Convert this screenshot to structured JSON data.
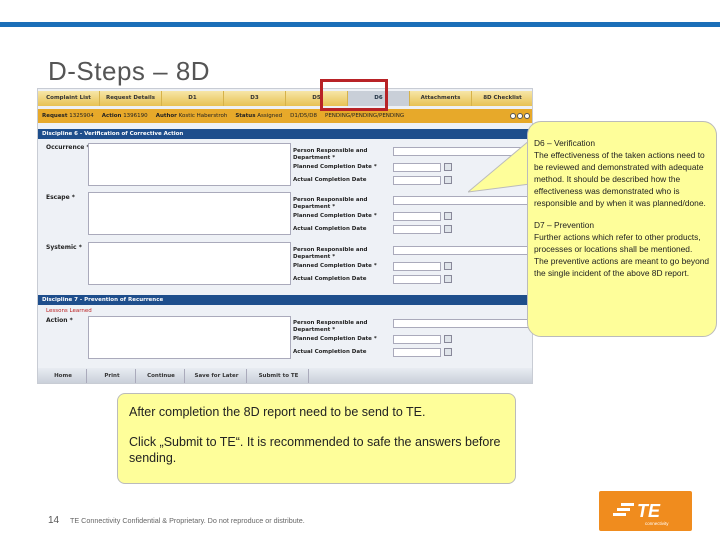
{
  "slide": {
    "title": "D-Steps – 8D",
    "page_number": "14",
    "footer": "TE Connectivity Confidential & Proprietary. Do not reproduce or distribute."
  },
  "app": {
    "tabs": [
      {
        "label": "Complaint List",
        "active": false
      },
      {
        "label": "Request Details",
        "active": false
      },
      {
        "label": "D1",
        "active": false
      },
      {
        "label": "D3",
        "active": false
      },
      {
        "label": "D5",
        "active": false
      },
      {
        "label": "D6",
        "active": true
      },
      {
        "label": "Attachments",
        "active": false
      },
      {
        "label": "8D Checklist",
        "active": false
      }
    ],
    "info": {
      "request_label": "Request",
      "request_value": "1325904",
      "action_label": "Action",
      "action_value": "1396190",
      "author_label": "Author",
      "author_value": "Kostic Haberstroh",
      "status_label": "Status",
      "status_value": "Assigned",
      "steps_value": "D1/D5/D8",
      "pending_value": "PENDING/PENDING/PENDING"
    },
    "section6": {
      "title": "Discipline 6 - Verification of Corrective Action",
      "rows": [
        {
          "label": "Occurrence *"
        },
        {
          "label": "Escape *"
        },
        {
          "label": "Systemic *"
        }
      ]
    },
    "section7": {
      "title": "Discipline 7 - Prevention of Recurrence",
      "lessons": "Lessons Learned",
      "action_label": "Action *"
    },
    "field_labels": {
      "person": "Person Responsible and Department *",
      "planned": "Planned Completion Date *",
      "actual": "Actual Completion Date"
    },
    "buttons": [
      "Home",
      "Print",
      "Continue",
      "Save for Later",
      "Submit to TE"
    ]
  },
  "callout": {
    "d6_title": "D6 – Verification",
    "d6_text": "The effectiveness of the taken actions need to be reviewed and demonstrated with adequate method. It should be described how the effectiveness was demonstrated who is responsible and by when it was planned/done.",
    "d7_title": "D7 – Prevention",
    "d7_text": "Further actions which refer to other products, processes or locations shall be mentioned.",
    "d7_text2": "The preventive actions are meant to go beyond the single incident of the above 8D report."
  },
  "note": {
    "line1": "After completion the 8D report need to be send to TE.",
    "line2": "Click „Submit to TE“. It is recommended to safe the answers before sending."
  },
  "logo": {
    "main": "TE",
    "sub": "connectivity",
    "color": "#f08c1e"
  }
}
